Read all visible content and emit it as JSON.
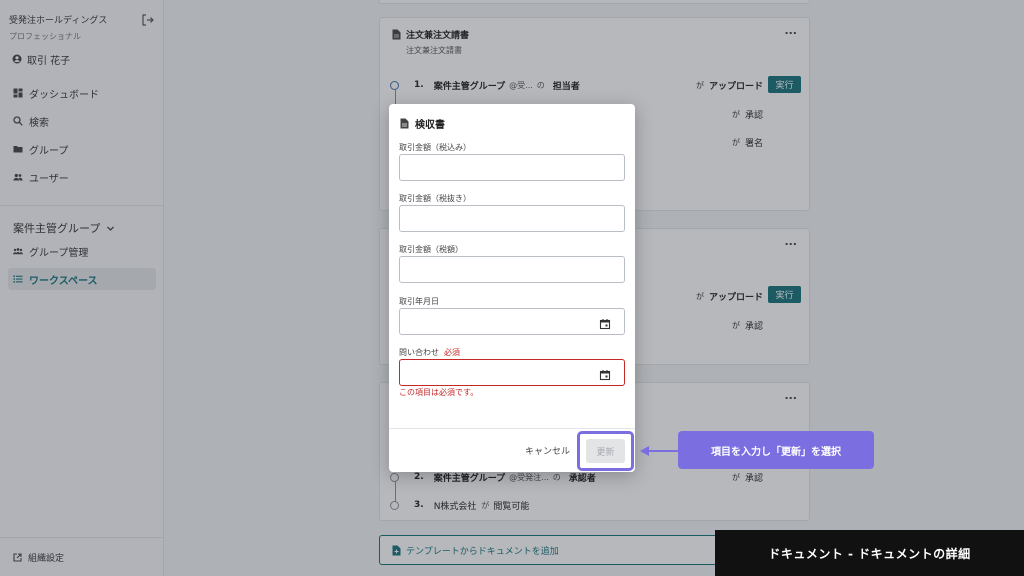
{
  "sidebar": {
    "org_name": "受発注ホールディングス",
    "plan": "プロフェッショナル",
    "user_name": "取引 花子",
    "nav": [
      {
        "label": "ダッシュボード",
        "icon": "dashboard-icon"
      },
      {
        "label": "検索",
        "icon": "search-icon"
      },
      {
        "label": "グループ",
        "icon": "folder-icon"
      },
      {
        "label": "ユーザー",
        "icon": "users-icon"
      }
    ],
    "group_name": "案件主管グループ",
    "group_items": [
      {
        "label": "グループ管理",
        "icon": "group-icon"
      },
      {
        "label": "ワークスペース",
        "icon": "list-icon",
        "active": true
      }
    ],
    "settings_label": "組織設定"
  },
  "cards": {
    "card1": {
      "title": "注文兼注文請書",
      "subtitle": "注文兼注文請書",
      "menu": "...",
      "step1": {
        "num": "1.",
        "group": "案件主管グループ",
        "member": "@受...",
        "particle": "の",
        "role": "担当者",
        "ga": "が",
        "action": "アップロード",
        "button": "実行"
      },
      "step2": {
        "ga": "が",
        "action": "承認"
      },
      "step3": {
        "ga": "が",
        "action": "署名"
      }
    },
    "card2": {
      "menu": "...",
      "step1": {
        "ga": "が",
        "action": "アップロード",
        "button": "実行"
      },
      "step2": {
        "ga": "が",
        "action": "承認"
      }
    },
    "card3": {
      "menu": "...",
      "step2": {
        "num": "2.",
        "group": "案件主管グループ",
        "member": "@受発注...",
        "particle": "の",
        "role": "承認者",
        "ga": "が",
        "action": "承認"
      },
      "step3": {
        "num": "3.",
        "company": "N株式会社",
        "ga": "が",
        "action": "閲覧可能"
      }
    },
    "add_template": "テンプレートからドキュメントを追加"
  },
  "modal": {
    "title": "検収書",
    "fields": [
      {
        "label": "取引金額（税込み）",
        "value": ""
      },
      {
        "label": "取引金額（税抜き）",
        "value": ""
      },
      {
        "label": "取引金額（税額）",
        "value": ""
      },
      {
        "label": "取引年月日",
        "value": ""
      },
      {
        "label": "問い合わせ",
        "required": "必須",
        "value": "",
        "error": "この項目は必須です。"
      }
    ],
    "cancel": "キャンセル",
    "update": "更新"
  },
  "callout": "項目を入力し「更新」を選択",
  "caption": "ドキュメント - ドキュメントの詳細",
  "colors": {
    "accent": "#16737a",
    "callout": "#7b6ee0",
    "error": "#c62828"
  }
}
